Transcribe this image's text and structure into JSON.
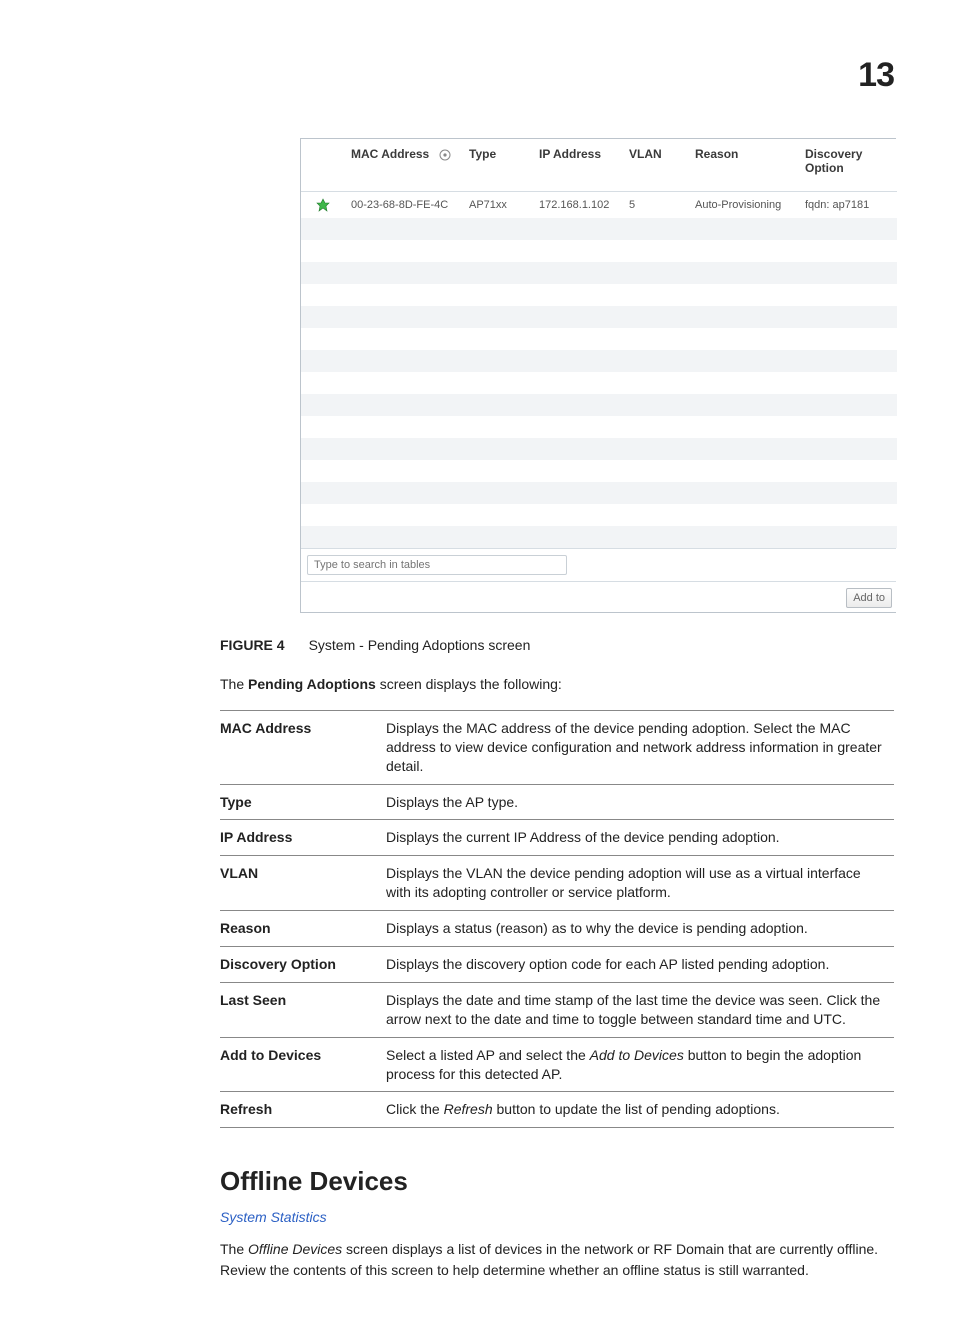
{
  "page_number": "13",
  "screenshot": {
    "columns": [
      "",
      "MAC Address",
      "Type",
      "IP Address",
      "VLAN",
      "Reason",
      "Discovery Option"
    ],
    "sort_column_index": 1,
    "rows": [
      {
        "status": "green",
        "mac": "00-23-68-8D-FE-4C",
        "type": "AP71xx",
        "ip": "172.168.1.102",
        "vlan": "5",
        "reason": "Auto-Provisioning",
        "disc": "fqdn: ap7181"
      }
    ],
    "blank_row_count": 15,
    "search_placeholder": "Type to search in tables",
    "add_button_label": "Add to"
  },
  "figure": {
    "label": "FIGURE 4",
    "caption": "System - Pending Adoptions screen"
  },
  "lead_text_1": "The ",
  "lead_bold": "Pending Adoptions",
  "lead_text_2": " screen displays the following:",
  "def_rows": [
    {
      "term": "MAC Address",
      "desc": "Displays the MAC address of the device pending adoption. Select the MAC address to view device configuration and network address information in greater detail."
    },
    {
      "term": "Type",
      "desc": "Displays the AP type."
    },
    {
      "term": "IP Address",
      "desc": "Displays the current IP Address of the device pending adoption."
    },
    {
      "term": "VLAN",
      "desc": "Displays the VLAN the device pending adoption will use as a virtual interface with its adopting controller or service platform."
    },
    {
      "term": "Reason",
      "desc": "Displays a status (reason) as to why the device is pending adoption."
    },
    {
      "term": "Discovery Option",
      "desc": "Displays the discovery option code for each AP listed pending adoption."
    },
    {
      "term": "Last Seen",
      "desc": "Displays the date and time stamp of the last time the device was seen. Click the arrow next to the date and time to toggle between standard time and UTC."
    },
    {
      "term": "Add to Devices",
      "desc_parts": [
        "Select a listed AP and select the ",
        "Add to Devices",
        " button to begin the adoption process for this detected AP."
      ]
    },
    {
      "term": "Refresh",
      "desc_parts": [
        "Click the ",
        "Refresh",
        " button to update the list of pending adoptions."
      ]
    }
  ],
  "section_heading": "Offline Devices",
  "section_link": "System Statistics",
  "section_para_parts": [
    "The ",
    "Offline Devices",
    " screen displays a list of devices in the network or RF Domain that are currently offline. Review the contents of this screen to help determine whether an offline status is still warranted."
  ]
}
